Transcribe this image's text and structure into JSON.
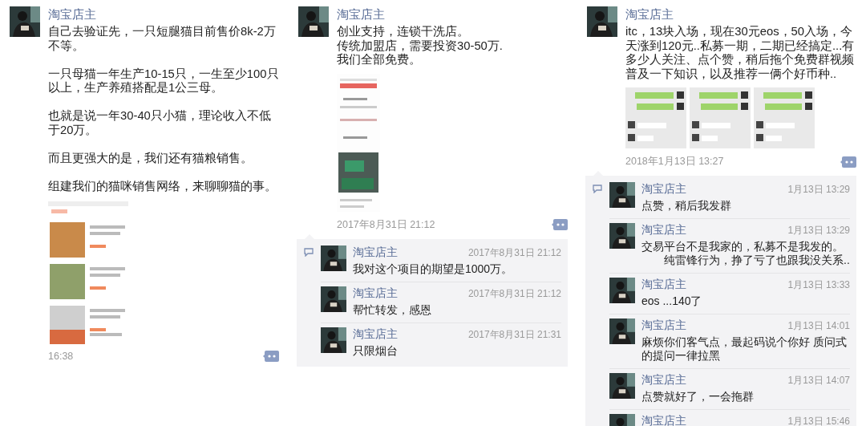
{
  "posts": [
    {
      "author": "淘宝店主",
      "paragraphs": [
        "自己去验证先，一只短腿猫目前售价8k-2万不等。",
        "一只母猫一年生产10-15只，一生至少100只以上，生产养殖搭配是1公三母。",
        "也就是说一年30-40只小猫，理论收入不低于20万。",
        "而且更强大的是，我们还有猫粮销售。",
        "组建我们的猫咪销售网络，来聊聊猫的事。"
      ],
      "images": [
        {
          "kind": "listing"
        }
      ],
      "time": "16:38"
    },
    {
      "author": "淘宝店主",
      "lines": [
        "创业支持，连锁干洗店。",
        "传统加盟店，需要投资30-50万.",
        "我们全部免费。"
      ],
      "images": [
        {
          "kind": "article"
        }
      ],
      "time": "2017年8月31日 21:12",
      "comments": [
        {
          "author": "淘宝店主",
          "time": "2017年8月31日 21:12",
          "lines": [
            "我对这个项目的期望是1000万。"
          ]
        },
        {
          "author": "淘宝店主",
          "time": "2017年8月31日 21:12",
          "lines": [
            "帮忙转发，感恩"
          ]
        },
        {
          "author": "淘宝店主",
          "time": "2017年8月31日 21:31",
          "lines": [
            "只限烟台"
          ]
        }
      ]
    },
    {
      "author": "淘宝店主",
      "paragraphs": [
        "itc，13块入场，现在30元eos，50入场，今天涨到120元..私募一期，二期已经搞定...有多少人关注、点个赞，稍后拖个免费群视频普及一下知识，以及推荐一俩个好币种.."
      ],
      "images": [
        {
          "kind": "chat"
        },
        {
          "kind": "chat"
        },
        {
          "kind": "chat"
        }
      ],
      "time": "2018年1月13日 13:27",
      "comments": [
        {
          "author": "淘宝店主",
          "time": "1月13日 13:29",
          "lines": [
            "点赞，稍后我发群"
          ]
        },
        {
          "author": "淘宝店主",
          "time": "1月13日 13:29",
          "lines": [
            "交易平台不是我家的，私募不是我发的。",
            "纯雷锋行为，挣了亏了也跟我没关系.."
          ]
        },
        {
          "author": "淘宝店主",
          "time": "1月13日 13:33",
          "lines": [
            "eos  ...140了"
          ]
        },
        {
          "author": "淘宝店主",
          "time": "1月13日 14:01",
          "lines": [
            "麻烦你们客气点，最起码说个你好 质问式的提问一律拉黑"
          ]
        },
        {
          "author": "淘宝店主",
          "time": "1月13日 14:07",
          "lines": [
            "点赞就好了，一会拖群"
          ]
        },
        {
          "author": "淘宝店主",
          "time": "1月13日 15:46"
        }
      ]
    }
  ]
}
